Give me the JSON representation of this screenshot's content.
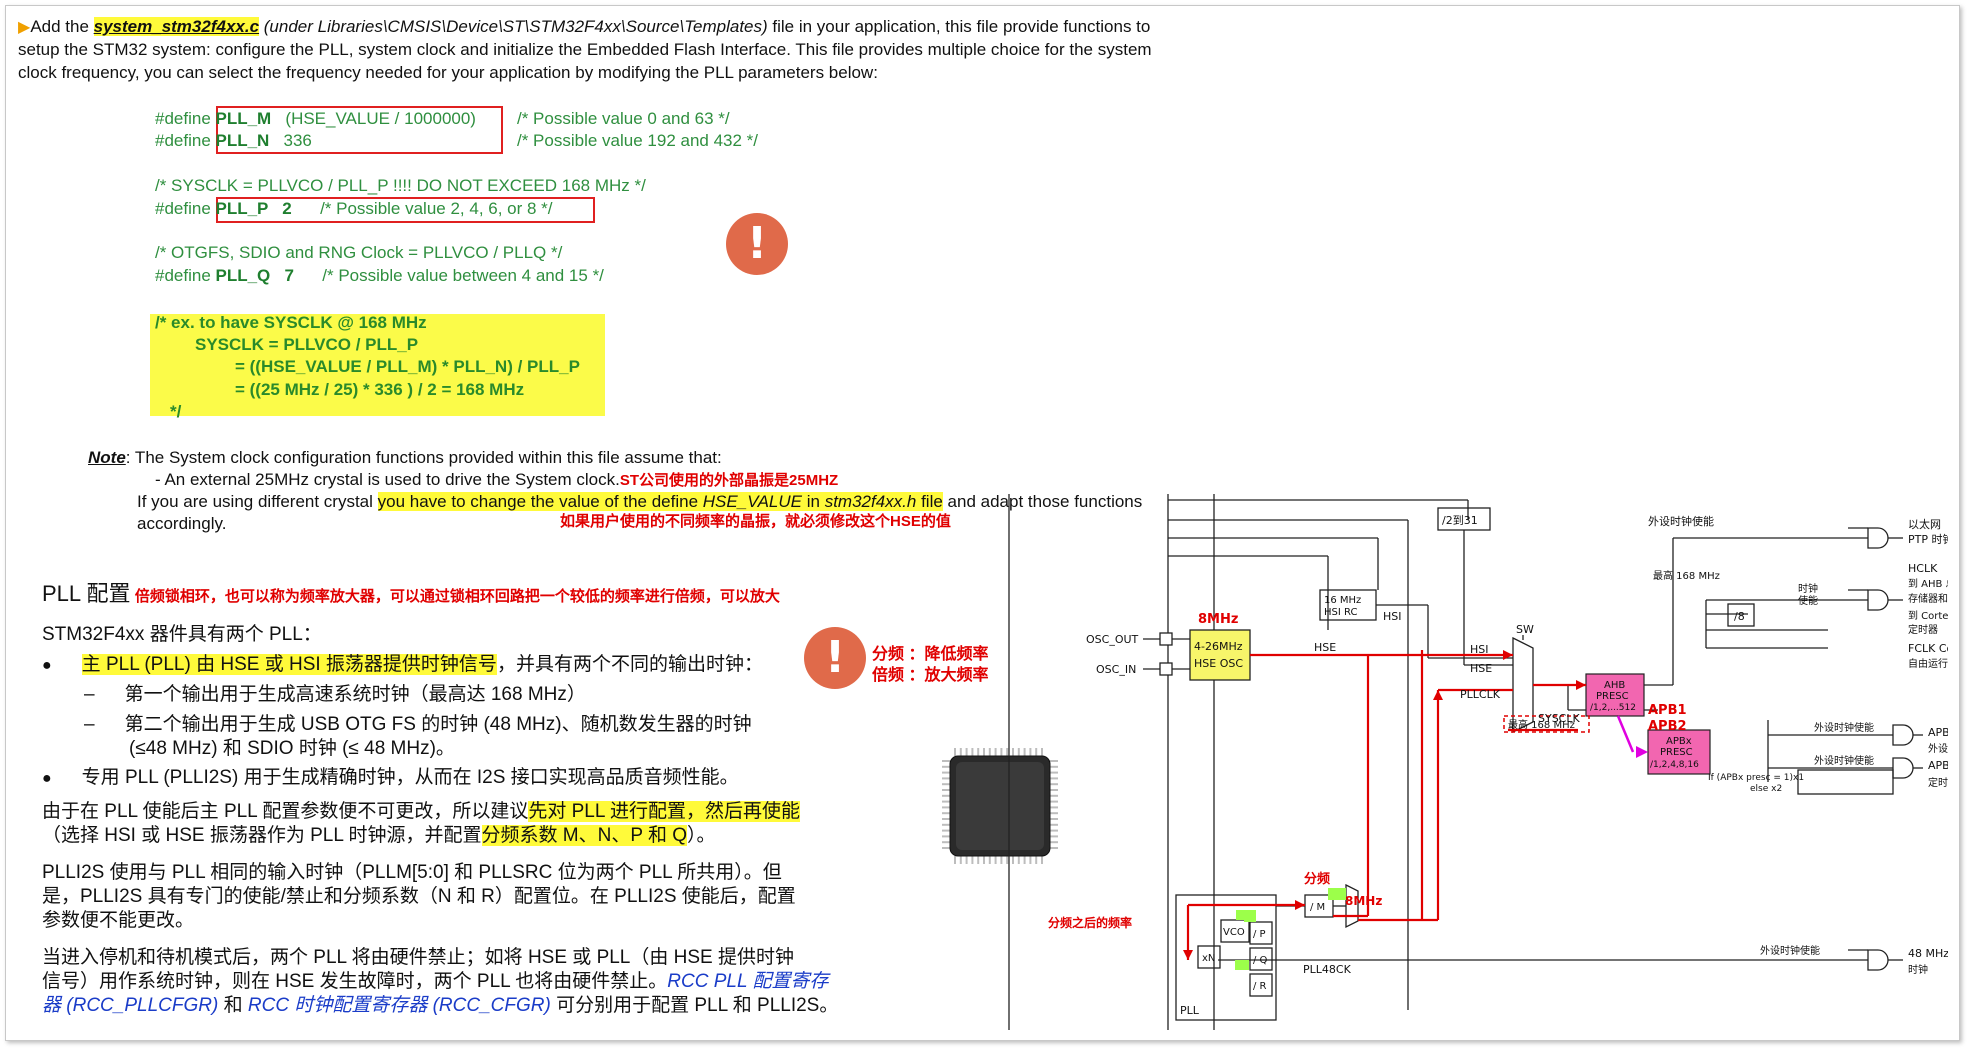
{
  "intro": {
    "add": "Add the ",
    "filename": "system_stm32f4xx.c",
    "path": " (under Libraries\\CMSIS\\Device\\ST\\STM32F4xx\\Source\\Templates)",
    "rest1": " file in your application, this file provide functions to",
    "line2": "setup the STM32 system: configure the PLL, system clock and initialize the Embedded Flash Interface. This file provides multiple choice for the system",
    "line3": "clock  frequency, you can select the frequency needed for your application by modifying the PLL parameters below:"
  },
  "code": {
    "pllm_define": "#define ",
    "pllm_name": "PLL_M",
    "pllm_value": "   (HSE_VALUE / 1000000)",
    "pllm_comment": "/* Possible value 0 and 63 */",
    "plln_define": "#define ",
    "plln_name": "PLL_N",
    "plln_value": "   336",
    "plln_comment": "/* Possible value 192 and 432 */",
    "sysclk_comment": "/* SYSCLK = PLLVCO / PLL_P !!!! DO NOT EXCEED 168 MHz */",
    "pllp_define": "#define ",
    "pllp_name": "PLL_P",
    "pllp_value": "   2",
    "pllp_comment": "/* Possible value 2, 4, 6, or 8 */",
    "otg_comment": "/* OTGFS, SDIO and RNG Clock =  PLLVCO / PLLQ */",
    "pllq_define": "#define ",
    "pllq_name": "PLL_Q",
    "pllq_value": "   7",
    "pllq_comment": "/* Possible value between 4 and 15 */"
  },
  "example": {
    "l1": "/* ex. to have SYSCLK @  168 MHz",
    "l2": "SYSCLK = PLLVCO / PLL_P",
    "l3": "= ((HSE_VALUE / PLL_M) * PLL_N) / PLL_P",
    "l4": "= ((25 MHz / 25) * 336 ) / 2 = 168 MHz",
    "l5": "*/"
  },
  "note": {
    "label": "Note",
    "colon": ":",
    "l1": " The System clock configuration functions provided within this file assume that:",
    "l2": "- An external 25MHz crystal is used to drive the System clock.",
    "l2_cn": "ST公司使用的外部晶振是25MHZ",
    "l3_a": "If you are using different crystal ",
    "l3_hl": "you have to change the value of the define ",
    "l3_it1": "HSE_VALUE",
    "l3_hl2": " in ",
    "l3_it2": "stm32f4xx.h",
    "l3_hl3": " file",
    "l3_b": " and adapt those functions",
    "l4": "accordingly.",
    "l4_cn": "如果用户使用的不同频率的晶振，就必须修改这个HSE的值"
  },
  "pll_section": {
    "title": "PLL 配置",
    "title_note": "倍频锁相环，也可以称为频率放大器，可以通过锁相环回路把一个较低的频率进行倍频，可以放大",
    "p1": "STM32F4xx 器件具有两个 PLL：",
    "b1_hl": "主 PLL (PLL) 由 HSE 或 HSI 振荡器提供时钟信号",
    "b1_rest": "，并具有两个不同的输出时钟：",
    "d1": "第一个输出用于生成高速系统时钟（最高达 168 MHz）",
    "d2a": "第二个输出用于生成 USB OTG FS 的时钟 (48 MHz)、随机数发生器的时钟",
    "d2b": "(≤48 MHz) 和 SDIO 时钟 (≤ 48 MHz)。",
    "b2": "专用 PLL (PLLI2S) 用于生成精确时钟，从而在 I2S 接口实现高品质音频性能。",
    "p2a": "由于在 PLL 使能后主 PLL 配置参数便不可更改，所以建议",
    "p2a_hl": "先对 PLL 进行配置，然后再使能",
    "p2b": "（选择 HSI 或 HSE 振荡器作为 PLL 时钟源，并配置",
    "p2b_hl": "分频系数 M、N、P 和 Q",
    "p2b_end": "）。",
    "p3a": "PLLI2S 使用与 PLL 相同的输入时钟（PLLM[5:0] 和 PLLSRC 位为两个 PLL 所共用）。但",
    "p3b": "是，PLLI2S 具有专门的使能/禁止和分频系数（N 和 R）配置位。在 PLLI2S 使能后，配置",
    "p3c": "参数便不能更改。",
    "p4a": "当进入停机和待机模式后，两个 PLL 将由硬件禁止；如将 HSE 或 PLL（由 HSE 提供时钟",
    "p4b": "信号）用作系统时钟，则在 HSE 发生故障时，两个 PLL 也将由硬件禁止。",
    "p4b_link": "RCC PLL 配置寄存",
    "p4c_link1": "器 (RCC_PLLCFGR)",
    "p4c_mid": " 和 ",
    "p4c_link2": "RCC 时钟配置寄存器 (RCC_CFGR)",
    "p4c_end": " 可分别用于配置 PLL 和 PLLI2S。"
  },
  "side_note": {
    "l1": "分频 ：降低频率",
    "l2": "倍频 ：放大频率"
  },
  "diagram": {
    "div2to31": "/2到31",
    "hsi_rc_1": "16 MHz",
    "hsi_rc_2": "HSI RC",
    "hsi": "HSI",
    "hsi_in": "HSI",
    "hse_in": "HSE",
    "pllclk": "PLLCLK",
    "sw": "SW",
    "sysclk": "SYSCLK",
    "max168": "最高 168 MHz",
    "max168_top": "最高 168 MHz",
    "ahb1": "AHB",
    "ahb2": "PRESC",
    "ahb3": "/1,2,...512",
    "apb1": "APB1",
    "apb2": "APB2",
    "apbx1": "APBx",
    "apbx2": "PRESC",
    "apbx3": "/1,2,4,8,16",
    "apb_if1": "If (APBx presc = 1)x1",
    "apb_if2": "else x2",
    "periph_en": "外设时钟使能",
    "eth_1": "以太网",
    "eth_2": "PTP 时钟",
    "clk_en_1": "时钟",
    "clk_en_2": "使能",
    "hclk_1": "HCLK",
    "hclk_2": "到 AHB 总线、内核、",
    "hclk_3": "存储器和 DMA",
    "div8": "/8",
    "cortex_1": "到 Cortex 系统",
    "cortex_2": "定时器",
    "fclk_1": "FCLK Cortex",
    "fclk_2": "自由运行时钟",
    "periph_en2": "外设时钟使能",
    "apbx_out_1": "APBx",
    "apbx_out_2": "外设时钟",
    "periph_en3": "外设时钟使能",
    "apbx_tim_1": "APBx",
    "apbx_tim_2": "定时器时钟",
    "osc_out": "OSC_OUT",
    "osc_in": "OSC_IN",
    "mhz8_a": "8MHz",
    "hse_osc_1": "4-26MHz",
    "hse_osc_2": "HSE OSC",
    "hse_line": "HSE",
    "fenpin": "分频",
    "div_m": "/ M",
    "mhz8_b": "8MHz",
    "after_div": "分频之后的频率",
    "vco": "VCO",
    "xn": "xN",
    "div_p": "/ P",
    "div_q": "/ Q",
    "div_r": "/ R",
    "pll": "PLL",
    "pll48ck": "PLL48CK",
    "periph_en4": "外设时钟使能",
    "mhz48_1": "48 MHz",
    "mhz48_2": "时钟"
  }
}
